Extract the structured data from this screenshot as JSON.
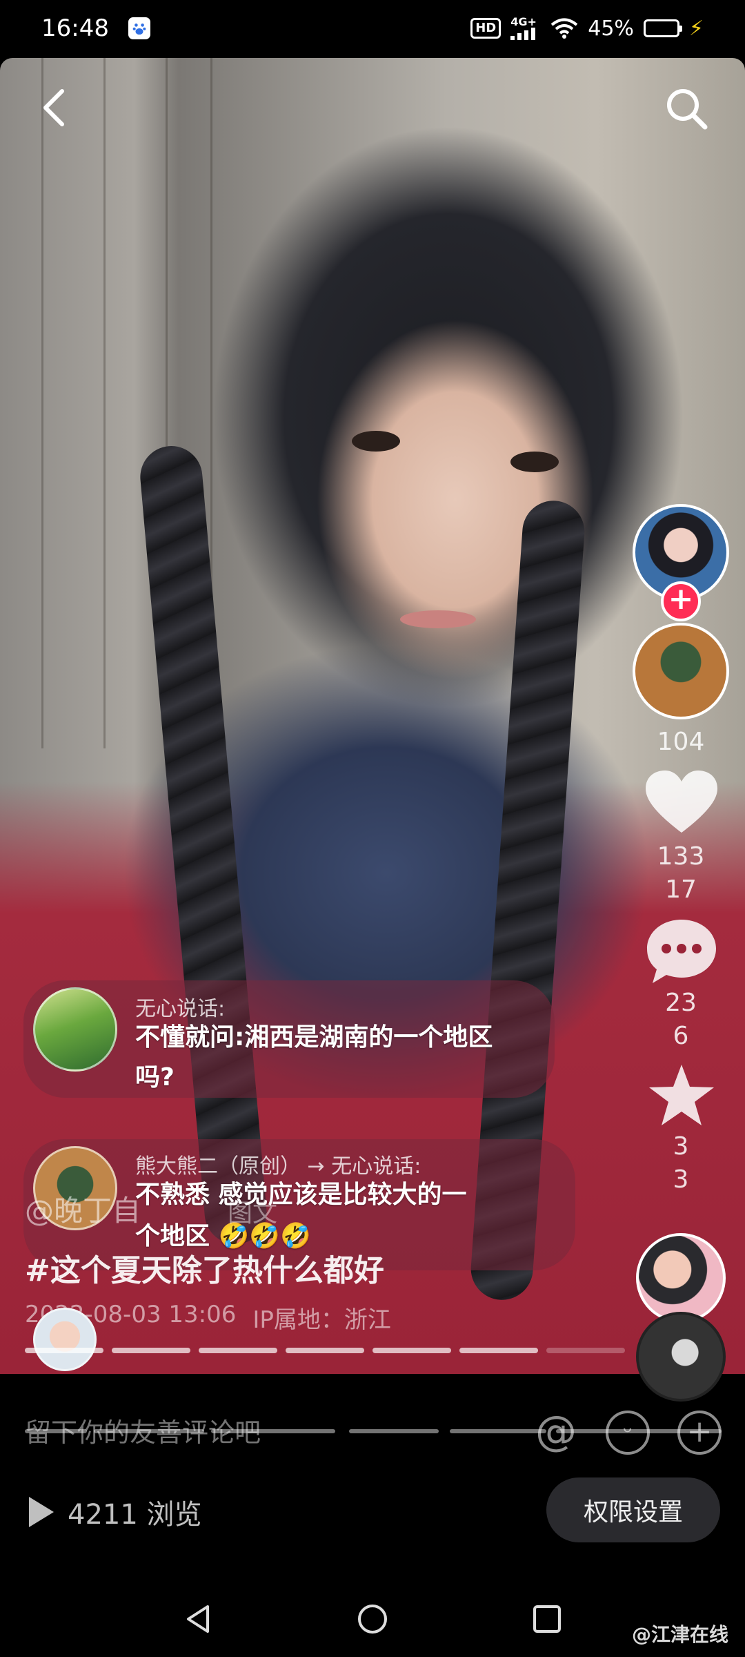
{
  "status_bar": {
    "time": "16:48",
    "hd": "HD",
    "network": "4G+",
    "battery_percent": "45%",
    "battery_level": 0.45,
    "icons": [
      "baidu-app-icon",
      "wifi-icon",
      "signal-icon",
      "battery-icon",
      "charging-bolt-icon"
    ]
  },
  "header": {
    "back_icon": "chevron-left-icon",
    "search_icon": "search-icon"
  },
  "right_rail": {
    "avatar_count": "104",
    "like_count": "133",
    "like_count_sub": "17",
    "comment_count": "23",
    "comment_count_sub": "6",
    "favorite_count": "3",
    "favorite_count_sub": "3"
  },
  "comments": [
    {
      "name": "无心说话:",
      "line1": "不懂就问:湘西是湖南的一个地区",
      "line2": "吗?"
    },
    {
      "name": "熊大熊二（原创） → 无心说话:",
      "line1": "不熟悉 感觉应该是比较大的一",
      "line2": "个地区 🤣🤣🤣"
    }
  ],
  "post": {
    "author": "@晚丁自",
    "type": "图文",
    "hashtag": "#这个夏天除了热什么都好",
    "date": "2022-08-03 13:06",
    "ip_location": "IP属地：浙江"
  },
  "progress": {
    "segments": 7,
    "current": 6
  },
  "comment_bar": {
    "placeholder": "留下你的友善评论吧",
    "icons": [
      "at-icon",
      "emoji-icon",
      "add-icon"
    ]
  },
  "footer": {
    "views": "4211 浏览",
    "permission_button": "权限设置"
  },
  "watermark": "@江津在线"
}
